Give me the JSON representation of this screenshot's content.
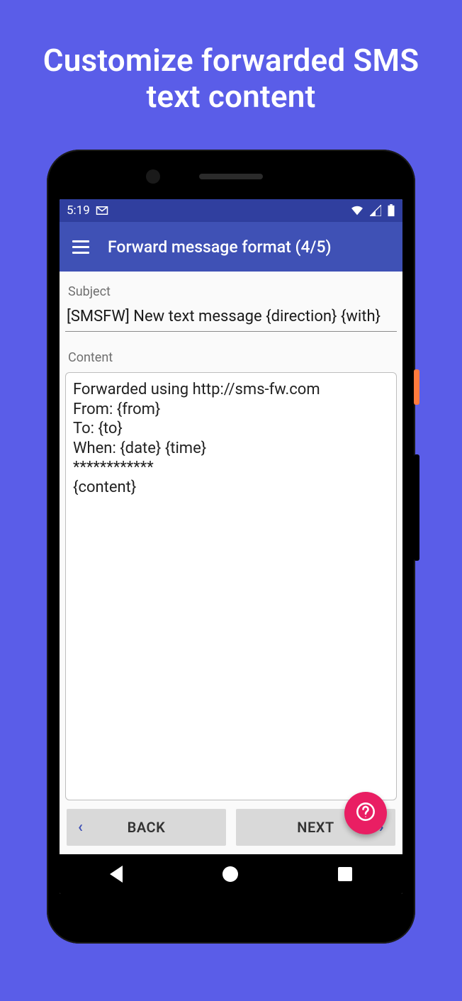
{
  "promo": {
    "title_l1": "Customize forwarded SMS",
    "title_l2": "text content"
  },
  "statusbar": {
    "time": "5:19"
  },
  "appbar": {
    "title": "Forward message format (4/5)"
  },
  "form": {
    "subject_label": "Subject",
    "subject_value": "[SMSFW] New text message {direction} {with}",
    "content_label": "Content",
    "content_value": "Forwarded using http://sms-fw.com\nFrom: {from}\nTo: {to}\nWhen: {date} {time}\n************\n{content}"
  },
  "buttons": {
    "back": "BACK",
    "next": "NEXT"
  }
}
